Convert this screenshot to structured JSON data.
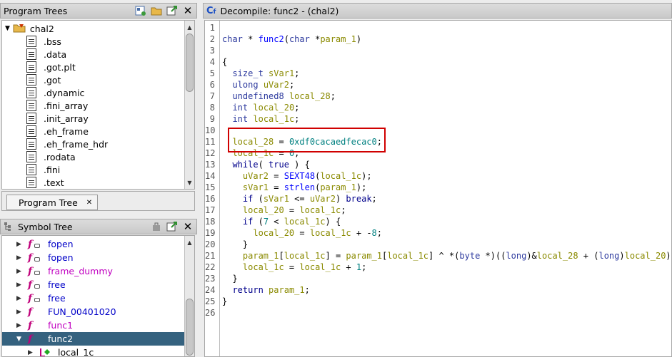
{
  "program_trees": {
    "title": "Program Trees",
    "root": "chal2",
    "sections": [
      ".bss",
      ".data",
      ".got.plt",
      ".got",
      ".dynamic",
      ".fini_array",
      ".init_array",
      ".eh_frame",
      ".eh_frame_hdr",
      ".rodata",
      ".fini",
      ".text"
    ],
    "tab_label": "Program Tree"
  },
  "symbol_tree": {
    "title": "Symbol Tree",
    "items": [
      {
        "label": "fopen",
        "kind": "external-function"
      },
      {
        "label": "fopen",
        "kind": "external-function"
      },
      {
        "label": "frame_dummy",
        "kind": "external-function"
      },
      {
        "label": "free",
        "kind": "external-function"
      },
      {
        "label": "free",
        "kind": "external-function"
      },
      {
        "label": "FUN_00401020",
        "kind": "function"
      },
      {
        "label": "func1",
        "kind": "function"
      },
      {
        "label": "func2",
        "kind": "function",
        "expanded": true,
        "selected": true
      },
      {
        "label": "local_1c",
        "kind": "local-variable"
      }
    ]
  },
  "decompile": {
    "title": "Decompile: func2 -  (chal2)",
    "lines": [
      "",
      "char * func2(char *param_1)",
      "",
      "{",
      "  size_t sVar1;",
      "  ulong uVar2;",
      "  undefined8 local_28;",
      "  int local_20;",
      "  int local_1c;",
      "",
      "  local_28 = 0xdf0cacaedfecac0;",
      "  local_1c = 0;",
      "  while( true ) {",
      "    uVar2 = SEXT48(local_1c);",
      "    sVar1 = strlen(param_1);",
      "    if (sVar1 <= uVar2) break;",
      "    local_20 = local_1c;",
      "    if (7 < local_1c) {",
      "      local_20 = local_1c + -8;",
      "    }",
      "    param_1[local_1c] = param_1[local_1c] ^ *(byte *)((long)&local_28 + (long)local_20);",
      "    local_1c = local_1c + 1;",
      "  }",
      "  return param_1;",
      "}",
      ""
    ],
    "highlight_color": "#d00000"
  },
  "colors": {
    "selection": "#35627f",
    "function_icon": "#c0007a",
    "keyword": "#00008b",
    "variable": "#8a8a00",
    "constant": "#008080",
    "call": "#0000ff"
  }
}
